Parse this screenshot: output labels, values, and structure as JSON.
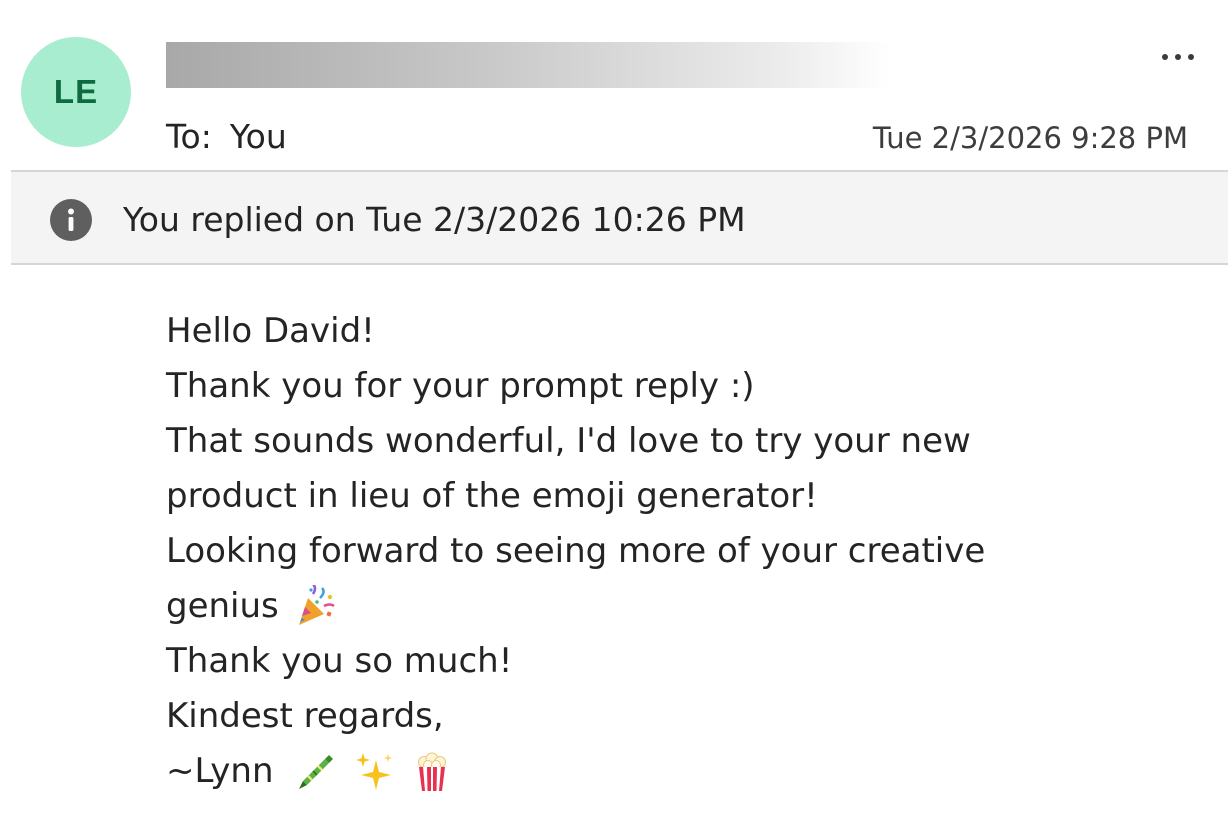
{
  "header": {
    "avatar_initials": "LE",
    "avatar_bg": "#a8edd0",
    "avatar_fg": "#0e6b3f",
    "to_label": "To:",
    "to_value": "You",
    "timestamp": "Tue 2/3/2026 9:28 PM",
    "more_icon": "more-horizontal-icon"
  },
  "info_bar": {
    "icon": "info-icon",
    "text": "You replied on Tue 2/3/2026 10:26 PM"
  },
  "body": {
    "lines": [
      "Hello David!",
      "Thank you for your prompt reply :)",
      "That sounds wonderful, I'd love to try your new",
      "product in lieu of the emoji generator!",
      "Looking forward to seeing more of your creative",
      "genius",
      "Thank you so much!",
      "Kindest regards,",
      "~Lynn"
    ],
    "emojis": {
      "genius": [
        "party-popper-icon"
      ],
      "signature": [
        "crayon-icon",
        "sparkles-icon",
        "popcorn-icon"
      ]
    }
  }
}
